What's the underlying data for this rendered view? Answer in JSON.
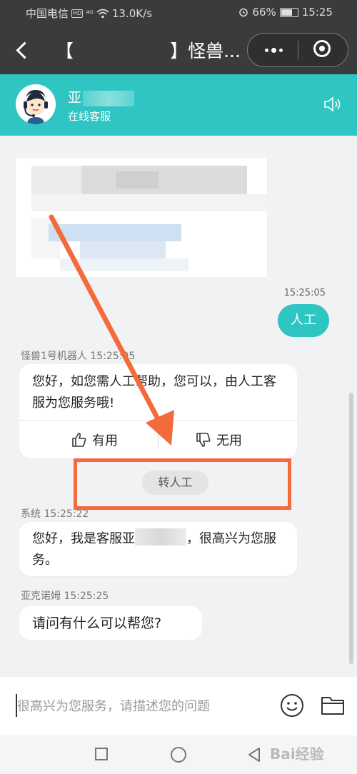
{
  "status_bar": {
    "carrier": "中国电信",
    "network_badge": "HD",
    "signal": "⁴ᴳ",
    "speed": "13.0K/s",
    "battery": "66%",
    "time": "15:25"
  },
  "title_bar": {
    "title": "【                 】怪兽..."
  },
  "agent_header": {
    "name_prefix": "亚",
    "role": "在线客服"
  },
  "chat": {
    "out_time": "15:25:05",
    "out_message": "人工",
    "bot_meta": "怪兽1号机器人 15:25:05",
    "bot_message": "您好，如您需人工帮助，您可以，由人工客服为您服务哦!",
    "useful_label": "有用",
    "useless_label": "无用",
    "transfer_label": "转人工",
    "system_meta": "系统 15:25:22",
    "system_message_start": "您好，我是客服亚",
    "system_message_end": "，很高兴为您服务。",
    "agent_meta": "亚克诺姆 15:25:25",
    "agent_message": "请问有什么可以帮您?"
  },
  "input": {
    "placeholder": "很高兴为您服务，请描述您的问题"
  },
  "watermark": "Bai经验",
  "colors": {
    "accent": "#2ec5c3",
    "annotation": "#f36a3d",
    "dark_bar": "#3b3b3b"
  }
}
